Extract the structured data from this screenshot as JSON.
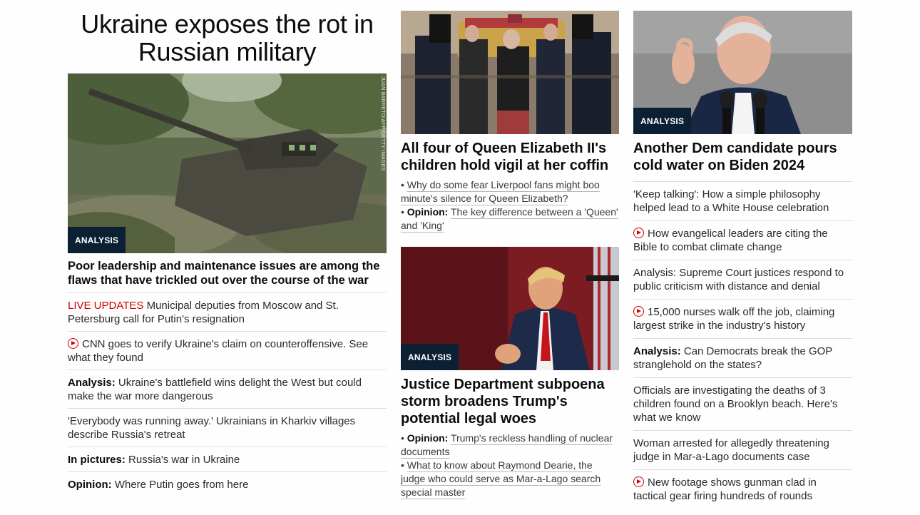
{
  "lead": {
    "headline": "Ukraine exposes the rot in Russian military",
    "image_alt": "Tank in forest",
    "photo_credit": "JUAN BARRETO/AFP/GETTY IMAGES",
    "badge": "ANALYSIS",
    "subhead": "Poor leadership and maintenance issues are among the flaws that have trickled out over the course of the war",
    "items": [
      {
        "prefix": "LIVE UPDATES",
        "text": "Municipal deputies from Moscow and St. Petersburg call for Putin's resignation"
      },
      {
        "video": true,
        "text": "CNN goes to verify Ukraine's claim on counteroffensive. See what they found"
      },
      {
        "prefix": "Analysis:",
        "text": "Ukraine's battlefield wins delight the West but could make the war more dangerous"
      },
      {
        "text": "'Everybody was running away.' Ukrainians in Kharkiv villages describe Russia's retreat"
      },
      {
        "prefix": "In pictures:",
        "text": "Russia's war in Ukraine"
      },
      {
        "prefix": "Opinion:",
        "text": "Where Putin goes from here"
      }
    ]
  },
  "queen": {
    "headline": "All four of Queen Elizabeth II's children hold vigil at her coffin",
    "bullets": [
      {
        "text": "Why do some fear Liverpool fans might boo minute's silence for Queen Elizabeth?"
      },
      {
        "prefix": "Opinion:",
        "text": "The key difference between a 'Queen' and 'King'"
      }
    ]
  },
  "trump": {
    "badge": "ANALYSIS",
    "headline": "Justice Department subpoena storm broadens Trump's potential legal woes",
    "bullets": [
      {
        "prefix": "Opinion:",
        "text": "Trump's reckless handling of nuclear documents"
      },
      {
        "text": "What to know about Raymond Dearie, the judge who could serve as Mar-a-Lago search special master"
      }
    ]
  },
  "biden": {
    "badge": "ANALYSIS",
    "headline": "Another Dem candidate pours cold water on Biden 2024",
    "items": [
      {
        "text": "'Keep talking': How a simple philosophy helped lead to a White House celebration"
      },
      {
        "video": true,
        "text": "How evangelical leaders are citing the Bible to combat climate change"
      },
      {
        "text": "Analysis: Supreme Court justices respond to public criticism with distance and denial"
      },
      {
        "video": true,
        "text": "15,000 nurses walk off the job, claiming largest strike in the industry's history"
      },
      {
        "prefix": "Analysis:",
        "text": "Can Democrats break the GOP stranglehold on the states?"
      },
      {
        "text": "Officials are investigating the deaths of 3 children found on a Brooklyn beach. Here's what we know"
      },
      {
        "text": "Woman arrested for allegedly threatening judge in Mar-a-Lago documents case"
      },
      {
        "video": true,
        "text": "New footage shows gunman clad in tactical gear firing hundreds of rounds"
      }
    ]
  },
  "colors": {
    "badge_bg": "#0c2034",
    "live": "#cc0000",
    "divider": "#dcdcdc"
  }
}
